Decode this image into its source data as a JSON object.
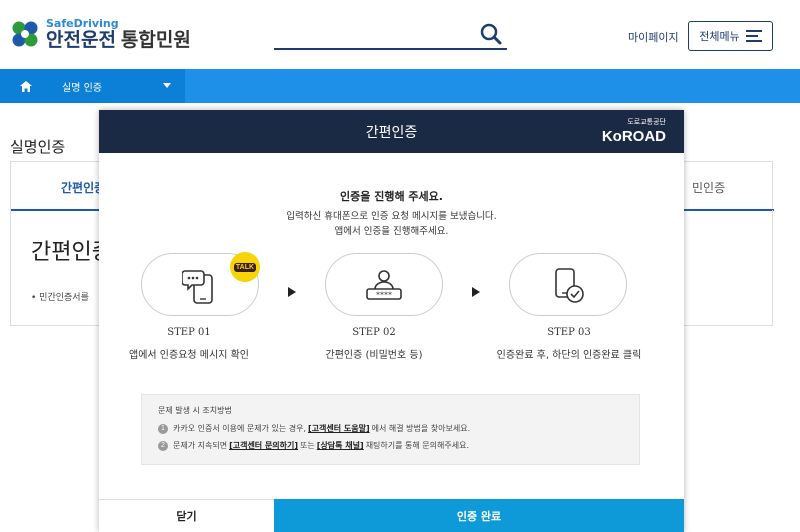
{
  "header": {
    "logo_en": "SafeDriving",
    "logo_ko_main": "안전운전",
    "logo_ko_sub": "통합민원",
    "mypage_label": "마이페이지",
    "allmenu_label": "전체메뉴"
  },
  "nav": {
    "breadcrumb": "실명 인증"
  },
  "page": {
    "title": "실명인증",
    "tab_active": "간편인증",
    "tab_right": "민인증",
    "heading": "간편인증",
    "note": "• 민간인증서를"
  },
  "modal": {
    "title": "간편인증",
    "brand_small": "도로교통공단",
    "brand": "KoROAD",
    "intro_title": "인증을 진행해 주세요.",
    "intro_line1": "입력하신 휴대폰으로 인증 요청 메시지를 보냈습니다.",
    "intro_line2": "앱에서 인증을 진행해주세요.",
    "talk_badge": "TALK",
    "steps": [
      {
        "label": "STEP 01",
        "desc": "앱에서 인증요청 메시지 확인"
      },
      {
        "label": "STEP 02",
        "desc": "간편인증 (비밀번호 등)"
      },
      {
        "label": "STEP 03",
        "desc": "인증완료 후, 하단의 인증완료 클릭"
      }
    ],
    "notice": {
      "title": "문제 발생 시 조치방법",
      "line1_num": "1",
      "line1_pre": "카카오 인증서 이용에 문제가 있는 경우,",
      "line1_link": "[고객센터 도움말]",
      "line1_post": "에서 해결 방법을 찾아보세요.",
      "line2_num": "2",
      "line2_pre": "문제가 지속되면",
      "line2_link1": "[고객센터 문의하기]",
      "line2_mid": "또는",
      "line2_link2": "[상담톡 채널]",
      "line2_post": "채팅하기를 통해 문의해주세요."
    },
    "close_label": "닫기",
    "done_label": "인증 완료"
  },
  "colors": {
    "navy": "#1b2a44",
    "nav_blue": "#1e90e8",
    "done_blue": "#0e9ad8",
    "kakao_yellow": "#f7d30a"
  }
}
